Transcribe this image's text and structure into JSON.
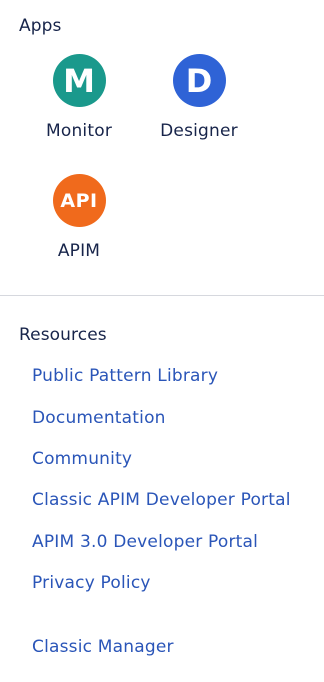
{
  "apps": {
    "title": "Apps",
    "items": [
      {
        "label": "Monitor",
        "letter": "M",
        "color": "#1a998c",
        "icon": "monitor-app-icon"
      },
      {
        "label": "Designer",
        "letter": "D",
        "color": "#2f63d6",
        "icon": "designer-app-icon"
      },
      {
        "label": "APIM",
        "letter": "API",
        "color": "#f06a1c",
        "icon": "apim-app-icon"
      }
    ]
  },
  "resources": {
    "title": "Resources",
    "links": [
      "Public Pattern Library",
      "Documentation",
      "Community",
      "Classic APIM Developer Portal",
      "APIM 3.0 Developer Portal",
      "Privacy Policy",
      "Classic Manager"
    ]
  },
  "colors": {
    "heading": "#17244a",
    "link": "#2a55b8",
    "divider": "#d6d8de"
  }
}
